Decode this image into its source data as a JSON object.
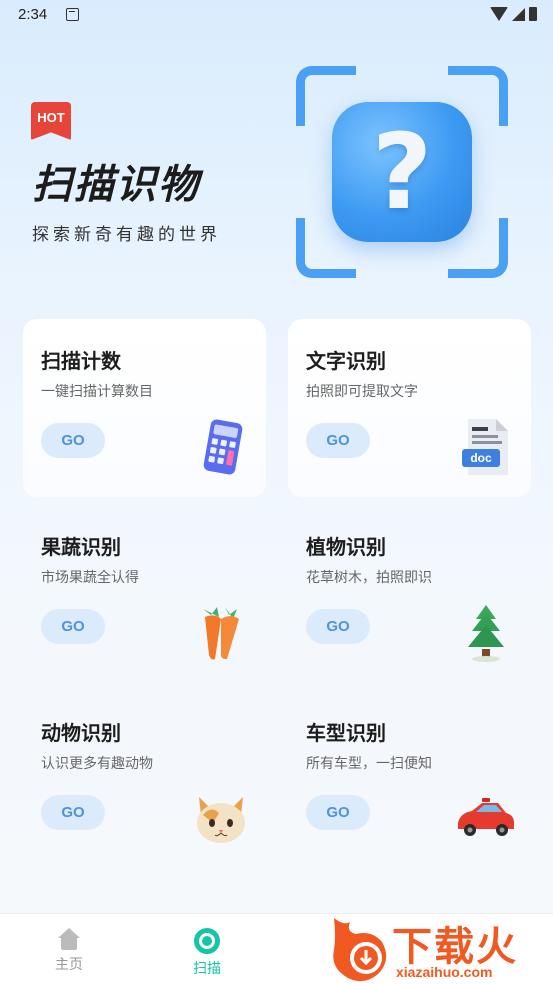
{
  "status_bar": {
    "time": "2:34"
  },
  "hero": {
    "badge": "HOT",
    "title": "扫描识物",
    "subtitle": "探索新奇有趣的世界",
    "question_mark": "?"
  },
  "cards": [
    {
      "title": "扫描计数",
      "subtitle": "一键扫描计算数目",
      "button": "GO",
      "icon": "calculator-icon"
    },
    {
      "title": "文字识别",
      "subtitle": "拍照即可提取文字",
      "button": "GO",
      "icon": "doc-file-icon",
      "icon_label": "doc"
    },
    {
      "title": "果蔬识别",
      "subtitle": "市场果蔬全认得",
      "button": "GO",
      "icon": "carrot-icon"
    },
    {
      "title": "植物识别",
      "subtitle": "花草树木，拍照即识",
      "button": "GO",
      "icon": "tree-icon"
    },
    {
      "title": "动物识别",
      "subtitle": "认识更多有趣动物",
      "button": "GO",
      "icon": "cat-icon"
    },
    {
      "title": "车型识别",
      "subtitle": "所有车型，一扫便知",
      "button": "GO",
      "icon": "car-icon"
    }
  ],
  "bottom_nav": {
    "items": [
      {
        "label": "主页",
        "icon": "home-icon",
        "color": "#999999"
      },
      {
        "label": "扫描",
        "icon": "scan-icon",
        "color": "#16c4a8"
      }
    ]
  },
  "watermark": {
    "text": "下载火",
    "url": "xiazaihuo.com"
  },
  "colors": {
    "accent": "#16c4a8",
    "go_bg": "#dcebfb",
    "go_text": "#4f93d8",
    "scan_blue": "#4aa0f5",
    "hot_red": "#e7443a"
  }
}
